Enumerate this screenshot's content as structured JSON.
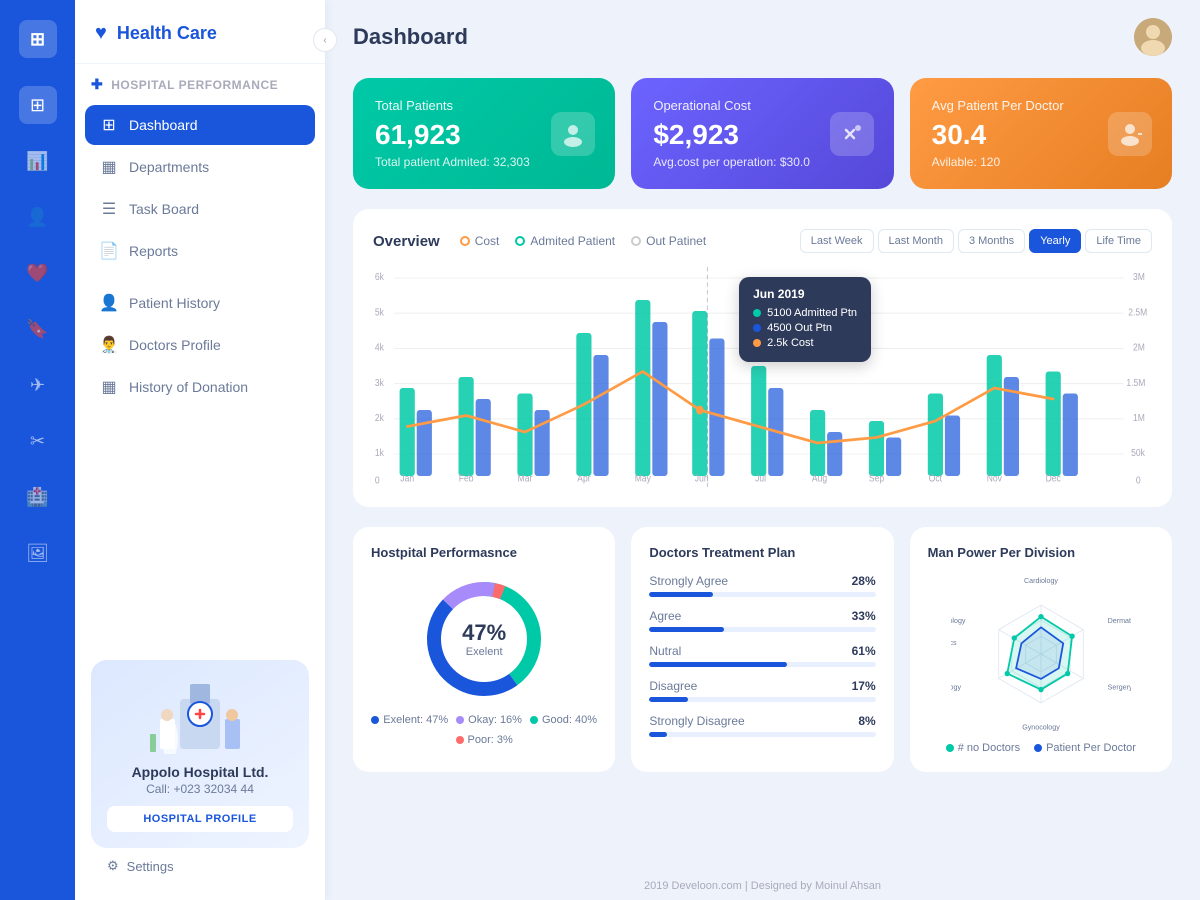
{
  "app": {
    "logo": "☰",
    "title": "Dashboard"
  },
  "icon_sidebar": {
    "logo": "⊞",
    "icons": [
      {
        "name": "dashboard-icon",
        "symbol": "⊞",
        "active": true
      },
      {
        "name": "chart-icon",
        "symbol": "📊"
      },
      {
        "name": "users-icon",
        "symbol": "👤"
      },
      {
        "name": "heart-icon",
        "symbol": "❤"
      },
      {
        "name": "bookmark-icon",
        "symbol": "🔖"
      },
      {
        "name": "plane-icon",
        "symbol": "✈"
      },
      {
        "name": "tools-icon",
        "symbol": "✂"
      },
      {
        "name": "hospital-icon",
        "symbol": "🏥"
      },
      {
        "name": "photo-icon",
        "symbol": "🖼"
      }
    ]
  },
  "sidebar": {
    "header": {
      "title": "Health Care",
      "icon": "♥"
    },
    "section1": {
      "title": "Hospital Performance",
      "icon": "+"
    },
    "menu": [
      {
        "label": "Dashboard",
        "icon": "⊞",
        "active": true
      },
      {
        "label": "Departments",
        "icon": "▦"
      },
      {
        "label": "Task Board",
        "icon": "☰"
      },
      {
        "label": "Reports",
        "icon": "📄"
      }
    ],
    "section2_items": [
      {
        "label": "Patient History",
        "icon": "👤"
      },
      {
        "label": "Doctors Profile",
        "icon": "👨‍⚕️"
      },
      {
        "label": "History of Donation",
        "icon": "▦"
      }
    ],
    "hospital_card": {
      "name": "Appolo Hospital Ltd.",
      "phone": "Call: +023 32034 44",
      "btn_label": "HOSPITAL PROFILE"
    },
    "settings": "Settings"
  },
  "stats": [
    {
      "title": "Total Patients",
      "value": "61,923",
      "sub": "Total patient Admited: 32,303",
      "color": "green",
      "icon": "👕"
    },
    {
      "title": "Operational Cost",
      "value": "$2,923",
      "sub": "Avg.cost per operation: $30.0",
      "color": "purple",
      "icon": "✂"
    },
    {
      "title": "Avg Patient Per Doctor",
      "value": "30.4",
      "sub": "Avilable: 120",
      "color": "orange",
      "icon": "👨‍⚕️"
    }
  ],
  "overview": {
    "title": "Overview",
    "legend": [
      {
        "label": "Cost",
        "type": "orange"
      },
      {
        "label": "Admited Patient",
        "type": "teal"
      },
      {
        "label": "Out Patinet",
        "type": "gray"
      }
    ],
    "time_filters": [
      "Last Week",
      "Last Month",
      "3 Months",
      "Yearly",
      "Life Time"
    ],
    "active_filter": "Yearly",
    "months": [
      "Jan",
      "Feb",
      "Mar",
      "Apr",
      "May",
      "Jun",
      "Jul",
      "Aug",
      "Sep",
      "Oct",
      "Nov",
      "Dec"
    ],
    "tooltip": {
      "date": "Jun 2019",
      "rows": [
        {
          "label": "5100 Admitted Ptn",
          "color": "#00c9a7"
        },
        {
          "label": "4500 Out Ptn",
          "color": "#1a56db"
        },
        {
          "label": "2.5k Cost",
          "color": "#ff9b44"
        }
      ]
    },
    "y_left": [
      "6k",
      "5k",
      "4k",
      "3k",
      "2k",
      "1k",
      "0"
    ],
    "y_right": [
      "3M",
      "2.5M",
      "2M",
      "1.5M",
      "1M",
      "50k",
      "0"
    ]
  },
  "hospital_performance": {
    "title": "Hostpital Performasnce",
    "donut_value": "47%",
    "donut_label": "Exelent",
    "legend": [
      {
        "label": "Exelent:",
        "value": "47%",
        "color": "#1a56db"
      },
      {
        "label": "Okay:",
        "value": "16%",
        "color": "#a78bfa"
      },
      {
        "label": "Good:",
        "value": "40%",
        "color": "#00c9a7"
      },
      {
        "label": "Poor:",
        "value": "3%",
        "color": "#ff6b6b"
      }
    ]
  },
  "doctors_treatment": {
    "title": "Doctors Treatment Plan",
    "rows": [
      {
        "label": "Strongly Agree",
        "pct": "28%",
        "val": 28
      },
      {
        "label": "Agree",
        "pct": "33%",
        "val": 33
      },
      {
        "label": "Nutral",
        "pct": "61%",
        "val": 61
      },
      {
        "label": "Disagree",
        "pct": "17%",
        "val": 17
      },
      {
        "label": "Strongly Disagree",
        "pct": "8%",
        "val": 8
      }
    ]
  },
  "manpower": {
    "title": "Man Power Per Division",
    "labels": [
      "Cardiology",
      "Dermatology",
      "Sergery",
      "Gynocology",
      "Nurology",
      "Concology",
      "Orthopedics"
    ],
    "legend": [
      {
        "label": "# no Doctors",
        "color": "#00c9a7"
      },
      {
        "label": "Patient Per Doctor",
        "color": "#1a56db"
      }
    ]
  },
  "footer": "2019 Develoon.com | Designed by Moinul Ahsan"
}
